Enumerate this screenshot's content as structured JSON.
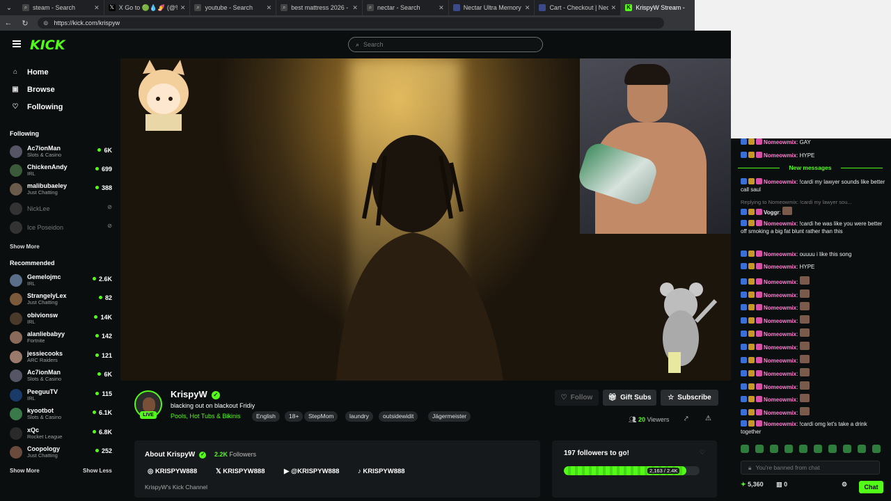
{
  "browser": {
    "tabs": [
      {
        "title": "steam - Search",
        "icon": "search-icon"
      },
      {
        "title": "X Go to 🟢💧🍠 (@%...",
        "icon": "x-icon"
      },
      {
        "title": "youtube - Search",
        "icon": "search-icon"
      },
      {
        "title": "best mattress 2026 - Se",
        "icon": "search-icon"
      },
      {
        "title": "nectar - Search",
        "icon": "search-icon"
      },
      {
        "title": "Nectar Ultra Memory",
        "icon": "nectar-icon"
      },
      {
        "title": "Cart - Checkout | Necta",
        "icon": "nectar-icon"
      },
      {
        "title": "KrispyW Stream -",
        "icon": "kick-icon"
      }
    ],
    "url": "https://kick.com/krispyw"
  },
  "site": {
    "logo": "KICK",
    "search_placeholder": "Search"
  },
  "sidebar": {
    "nav": [
      {
        "label": "Home",
        "icon": "home-icon"
      },
      {
        "label": "Browse",
        "icon": "browse-icon"
      },
      {
        "label": "Following",
        "icon": "heart-icon"
      }
    ],
    "following_title": "Following",
    "following": [
      {
        "name": "Ac7ionMan",
        "category": "Slots & Casino",
        "viewers": "6K",
        "live": true
      },
      {
        "name": "ChickenAndy",
        "category": "IRL",
        "viewers": "699",
        "live": true
      },
      {
        "name": "malibubaeley",
        "category": "Just Chatting",
        "viewers": "388",
        "live": true
      },
      {
        "name": "NickLee",
        "category": "",
        "viewers": "",
        "live": false
      },
      {
        "name": "Ice Poseidon",
        "category": "",
        "viewers": "",
        "live": false
      }
    ],
    "show_more_1": "Show More",
    "recommended_title": "Recommended",
    "recommended": [
      {
        "name": "Gemelojmc",
        "category": "IRL",
        "viewers": "2.6K"
      },
      {
        "name": "StrangelyLex",
        "category": "Just Chatting",
        "viewers": "82"
      },
      {
        "name": "obivionsw",
        "category": "IRL",
        "viewers": "14K"
      },
      {
        "name": "alanliebabyy",
        "category": "Fortnite",
        "viewers": "142"
      },
      {
        "name": "jessiecooks",
        "category": "ARC Raiders",
        "viewers": "121"
      },
      {
        "name": "Ac7ionMan",
        "category": "Slots & Casino",
        "viewers": "6K"
      },
      {
        "name": "PeeguuTV",
        "category": "IRL",
        "viewers": "115"
      },
      {
        "name": "kyootbot",
        "category": "Slots & Casino",
        "viewers": "6.1K"
      },
      {
        "name": "xQc",
        "category": "Rocket League",
        "viewers": "6.8K"
      },
      {
        "name": "Coopology",
        "category": "Just Chatting",
        "viewers": "252"
      }
    ],
    "show_more_2": "Show More",
    "show_less": "Show Less"
  },
  "stream": {
    "name": "KrispyW",
    "live_label": "LIVE",
    "title": "blacking out on blackout Fridiy",
    "category": "Pools, Hot Tubs & Bikinis",
    "tags": [
      "English",
      "18+",
      "StepMom",
      "laundry",
      "outsidewidit",
      "Jägermeister"
    ],
    "follow_label": "Follow",
    "gift_label": "Gift Subs",
    "subscribe_label": "Subscribe",
    "viewers_count": "20",
    "viewers_label": "Viewers"
  },
  "about": {
    "title": "About KrispyW",
    "followers_count": "2.2K",
    "followers_label": "Followers",
    "socials": [
      {
        "icon": "instagram-icon",
        "label": "KRISPYW888"
      },
      {
        "icon": "x-icon",
        "label": "KRISPYW888"
      },
      {
        "icon": "youtube-icon",
        "label": "@KRISPYW888"
      },
      {
        "icon": "tiktok-icon",
        "label": "KRISPYW888"
      }
    ],
    "description": "KrispyW's Kick Channel"
  },
  "goal": {
    "title": "197 followers to go!",
    "progress_text": "2,163 / 2.4K",
    "progress_fraction": 0.9
  },
  "chat": {
    "new_messages": "New messages",
    "messages": [
      {
        "user": "Nomeowmix",
        "text": "GAY"
      },
      {
        "user": "Nomeowmix",
        "text": "HYPE"
      },
      {
        "user": "Nomeowmix",
        "text": "!cardi my lawyer sounds like better call saul"
      },
      {
        "user": "",
        "text": "Replying to Nomeowmix: !cardi my lawyer sou..."
      },
      {
        "user": "Voggr",
        "text": ""
      },
      {
        "user": "Nomeowmix",
        "text": "!cardi he was like you were better off smoking a big fat blunt rather than this"
      },
      {
        "user": "Nomeowmix",
        "text": "ouuuu i like this song"
      },
      {
        "user": "Nomeowmix",
        "text": "HYPE"
      },
      {
        "user": "Nomeowmix",
        "text": ""
      },
      {
        "user": "Nomeowmix",
        "text": ""
      },
      {
        "user": "Nomeowmix",
        "text": ""
      },
      {
        "user": "Nomeowmix",
        "text": ""
      },
      {
        "user": "Nomeowmix",
        "text": ""
      },
      {
        "user": "Nomeowmix",
        "text": ""
      },
      {
        "user": "Nomeowmix",
        "text": ""
      },
      {
        "user": "Nomeowmix",
        "text": ""
      },
      {
        "user": "Nomeowmix",
        "text": ""
      },
      {
        "user": "Nomeowmix",
        "text": ""
      },
      {
        "user": "Nomeowmix",
        "text": ""
      },
      {
        "user": "Nomeowmix",
        "text": "!cardi omg let's take a drink together"
      }
    ],
    "banned_placeholder": "You're banned from chat",
    "points": "5,360",
    "gifts": "0",
    "chat_button": "Chat"
  },
  "colors": {
    "accent": "#53fc18",
    "background": "#0b0e0f",
    "panel": "#16191b"
  }
}
